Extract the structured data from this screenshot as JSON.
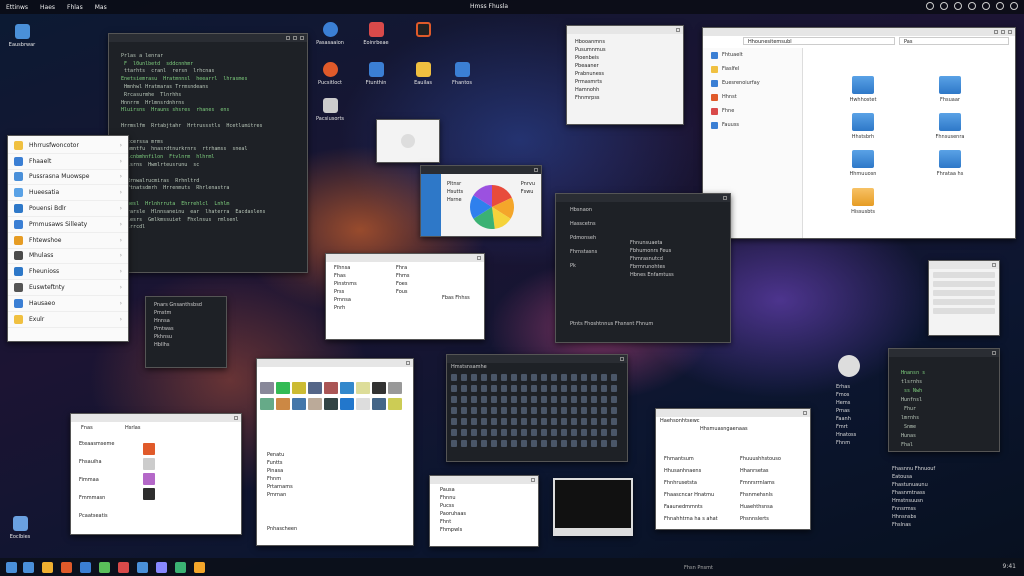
{
  "topbar": {
    "menus": [
      "Ettinws",
      "Haes",
      "Fhlas",
      "Mas"
    ],
    "center_title": "Hmss Fhusla"
  },
  "desktop_icons": [
    {
      "label": "Eausbrwar",
      "color": "#4a90d9"
    },
    {
      "label": "Pasasaaion",
      "color": "#3b7fd4"
    },
    {
      "label": "Eoinrbeae",
      "color": "#d94a4a"
    },
    {
      "label": "Pucsitloct",
      "color": "#e05a2a"
    },
    {
      "label": "Ftunthin",
      "color": "#3b7fd4"
    },
    {
      "label": "Eauilas",
      "color": "#f0c040"
    },
    {
      "label": "Fhantos",
      "color": "#3b7fd4"
    },
    {
      "label": "Pacsiusorts",
      "color": "#cccccc"
    },
    {
      "label": "Eoclbies",
      "color": "#6aa0e0"
    }
  ],
  "launcher": {
    "items": [
      "Hhrrusfwoncotor",
      "Fhaaelt",
      "Pussrasna Muowspe",
      "Hueesatia",
      "Pouensi Bdlr",
      "Prnmusaws Silleaty",
      "Fhtewshoe",
      "Mhulass",
      "Fheunioss",
      "Euswteftnty",
      "Hausaeo",
      "Exulr"
    ]
  },
  "code_window": {
    "lines": [
      "  Prlas a lenrar",
      "   F  l0unlbetd  sddcnnhmr",
      "   ttarhts  cranl  rersn  lrhcnas",
      "  Enetsiemrasu  Hratmnnsl  heearrl  lhrasmes",
      "   Hmnhwl Hratmaras Trrmsndeans",
      "   Rrcasurmhe  Tlnrhhs",
      "  Hnnrrm  Hrlmnsrdnhrns",
      "  Hluirsns  Hrauns shsres  rhanes  ens",
      "",
      "  Hrrmslfm  Rrtabjtahr  Hrtrussstls  Hcetlumitres",
      "",
      "   Ptcerssa mrms",
      "  Hlnmntfu  hnasrdtnurkrnrs  rtrhamss  sneal",
      "   Rlcnbmhnfilon  Ftvlnrm  hlhrml",
      "   Flsrns  Hwmlrteusrunu  sc",
      "",
      "    Rrnwalrucmiras  Rrhnltrd",
      "    Ftnatsdmrh  Hrrenmuts  Rhrlenastra",
      "",
      "  Urhesl  Hrlnhrruta  Ehrrehlcl  Lnhlm",
      "  Hrrarsle  Hlnnsaneinu  ear  lhaterra  Eacdaslens",
      "  Hrlesrs  Gmlkmssuiet  Fhxlnsus  rmlsenl",
      "   Hlrrcdl"
    ]
  },
  "file_manager": {
    "address": "Hhounesitemsubl",
    "search": "Pas",
    "sidebar": [
      "Fhtuaelt",
      "Fiaslfel",
      "Euesrenoiurfay",
      "Hhnst",
      "Fhne",
      "Fauuss"
    ],
    "folders": [
      "Hwhhostet",
      "Fhsuaar",
      "Hhstsbrh",
      "Fhnsusenra",
      "Hhmuuosn",
      "Fhrataa hs",
      "Hissusbts",
      "Rhlnn",
      "Hltsrtla",
      "Rhrmu seen"
    ]
  },
  "small_list_window": {
    "items": [
      "Hbooanmns",
      "Pusumnmus",
      "Pioenbeis",
      "Pbeaaner",
      "Prabnuness",
      "Prmasmrts",
      "Hamnohh",
      "Fhnmrpss"
    ]
  },
  "chart_window": {
    "type": "pie",
    "labels": [
      "Pltnsr",
      "Hsutts",
      "Hsrne",
      "Pnrvu",
      "Fswu"
    ],
    "slices": [
      {
        "value": 18,
        "color": "#e84b3c"
      },
      {
        "value": 16,
        "color": "#f4a62a"
      },
      {
        "value": 14,
        "color": "#f5d33b"
      },
      {
        "value": 18,
        "color": "#3bb273"
      },
      {
        "value": 18,
        "color": "#2f80ed"
      },
      {
        "value": 16,
        "color": "#9b51e0"
      }
    ]
  },
  "dark_panel": {
    "sidebar": [
      "Hbsnaon",
      "Hasscetns",
      "Pdmonseh",
      "Fhrnstasns",
      "Pk"
    ],
    "items": [
      "Fhnunsuaeta",
      "Fbhumonrs Feus",
      "Fhmrasnutcd",
      "Fbrmrunohtes",
      "Hbnes Enfamtuss"
    ],
    "footer": "Ptnts  Fhoshtnnus  Fhsnsnt  Fhnum"
  },
  "explorer2": {
    "title": "Flushitrr",
    "items": [
      "Flhnsa",
      "Fhas",
      "Pinstnms",
      "Prss",
      "Prnnsa",
      "Pnrh"
    ],
    "right": [
      "Fhra",
      "Fhms",
      "Foes",
      "Fous"
    ],
    "caption": "Fbas Fhhss"
  },
  "mini_menu": {
    "items": [
      "Pnars Gnsanthsbsd",
      "Pmstm",
      "Hnnsa",
      "Pmtwas",
      "Pkhnsu",
      "Hbllhs"
    ]
  },
  "gallery": {
    "rows": [
      "Penatu",
      "Funtts",
      "Pinasa",
      "Fhnm",
      "Prtarnams",
      "Pmrnan"
    ],
    "footer": "Pnhascheen"
  },
  "keyboard_window": {
    "title": "Hmstsnsamhe",
    "rows": 7,
    "cols": 17
  },
  "settings_window": {
    "title": "Hsrlas",
    "items": [
      "Eteaasmseme",
      "Fhsauiha",
      "Fimmaa",
      "Fmmmasn",
      "Pcaatseatis"
    ],
    "tabs": [
      "Fnas",
      "Fnns"
    ]
  },
  "small_dialog": {
    "items": [
      "Pausa",
      "Fhnnu",
      "Pucss",
      "Paoruhaas",
      "Fhnt",
      "Fhmpwls"
    ]
  },
  "video_window": {},
  "catalog_window": {
    "title": "Haehsonhtsewc",
    "header": "Hhsmuasngaenaas",
    "left": [
      "Fhmantsum",
      "Hhusanhnaens",
      "Fhnhrusetsta",
      "Fhaascncar Hnatmu",
      "Faaunedmmnts",
      "Fhnahhtrna ha s ahat"
    ],
    "right": [
      "Fhuuushhstouso",
      "Hhanrsetas",
      "Fmnrsrrnlams",
      "Fhsnmehsnls",
      "Huaehthsnsa",
      "Phsnnslerts"
    ]
  },
  "side_panel": {
    "items": [
      "Erhas",
      "Fmos",
      "Hems",
      "Prnas",
      "Faanh",
      "Fmrt",
      "Hnatoss",
      "Fhnm"
    ]
  },
  "right_list": {
    "items": [
      "Fhasnnu Fhnuouf",
      "Eatousa",
      "Fhastunuaunu",
      "Fhasnmtnass",
      "Hmstnsuusn",
      "Fnnsrmss",
      "Hhnsnsbs",
      "Fhslnas"
    ]
  },
  "terminal2": {
    "lines": [
      "  Hnansn s",
      "  tlsrnhs",
      "   ss Nwh",
      "  Hunfnsl",
      "   Fhur",
      "  lmrnhs",
      "   Snme",
      "  Hunas",
      "  Fhal"
    ]
  },
  "taskbar": {
    "clock": "9:41",
    "status": "Fhsn Pnsmt",
    "icons": [
      "#4a90d9",
      "#f0b030",
      "#e05a2a",
      "#3b7fd4",
      "#5abf5a",
      "#d94a4a",
      "#4a90d9",
      "#8888ff",
      "#3bb273",
      "#f4a62a"
    ]
  }
}
